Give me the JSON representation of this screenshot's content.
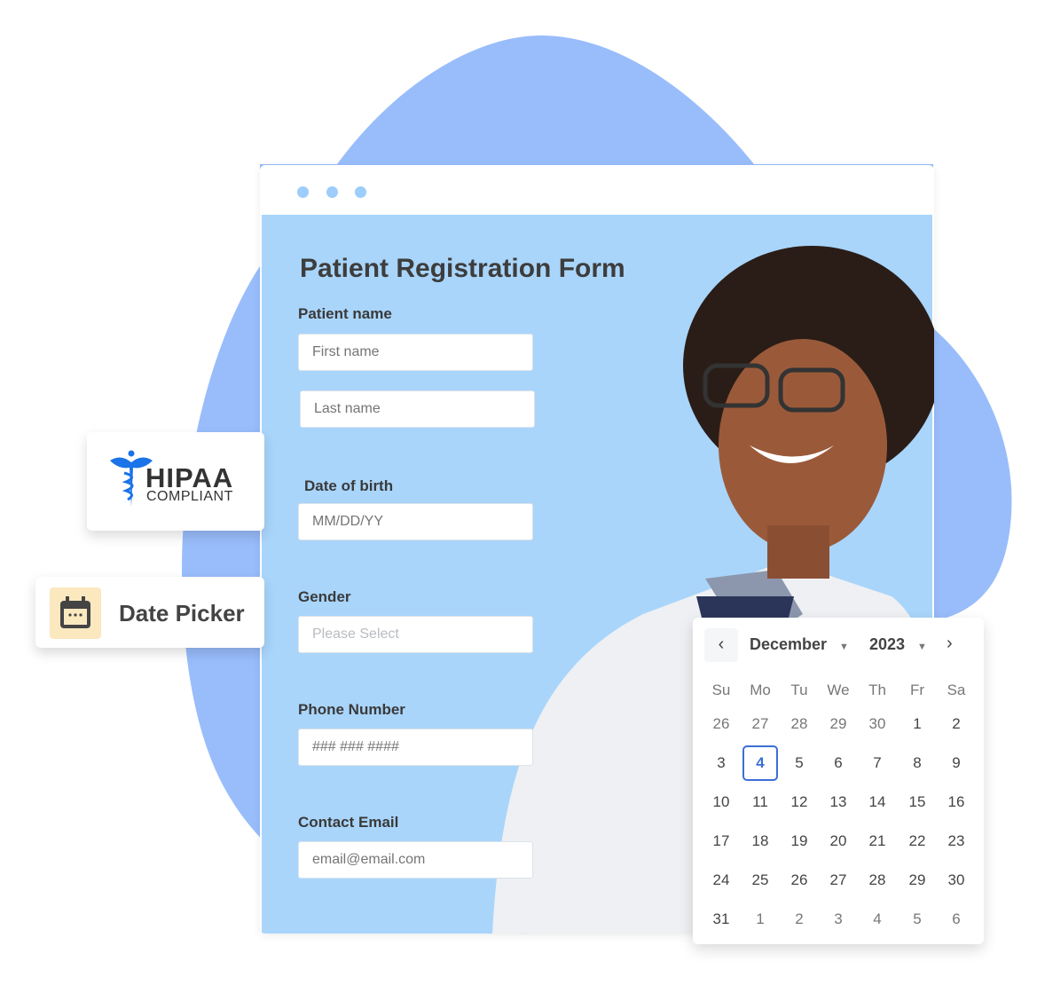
{
  "colors": {
    "blob": "#99bdfb",
    "form_bg": "#a9d5fb",
    "accent": "#3b6fd6",
    "hipaa_blue": "#1a73e8",
    "date_icon_bg": "#fbe8bf"
  },
  "badges": {
    "hipaa_top": "HIPAA",
    "hipaa_bottom": "COMPLIANT",
    "date_picker": "Date Picker",
    "hipaa_icon": "caduceus-icon",
    "date_icon": "calendar-icon"
  },
  "form": {
    "title": "Patient Registration Form",
    "patient_name_label": "Patient name",
    "first_name_placeholder": "First name",
    "last_name_placeholder": "Last name",
    "dob_label": "Date of birth",
    "dob_placeholder": "MM/DD/YY",
    "gender_label": "Gender",
    "gender_placeholder": "Please Select",
    "phone_label": "Phone Number",
    "phone_placeholder": "### ### ####",
    "email_label": "Contact Email",
    "email_placeholder": "email@email.com"
  },
  "calendar": {
    "month": "December",
    "year": "2023",
    "weekdays": [
      "Su",
      "Mo",
      "Tu",
      "We",
      "Th",
      "Fr",
      "Sa"
    ],
    "weeks": [
      [
        "26",
        "27",
        "28",
        "29",
        "30",
        "1",
        "2"
      ],
      [
        "3",
        "4",
        "5",
        "6",
        "7",
        "8",
        "9"
      ],
      [
        "10",
        "11",
        "12",
        "13",
        "14",
        "15",
        "16"
      ],
      [
        "17",
        "18",
        "19",
        "20",
        "21",
        "22",
        "23"
      ],
      [
        "24",
        "25",
        "26",
        "27",
        "28",
        "29",
        "30"
      ],
      [
        "31",
        "1",
        "2",
        "3",
        "4",
        "5",
        "6"
      ]
    ],
    "selected": "4"
  }
}
